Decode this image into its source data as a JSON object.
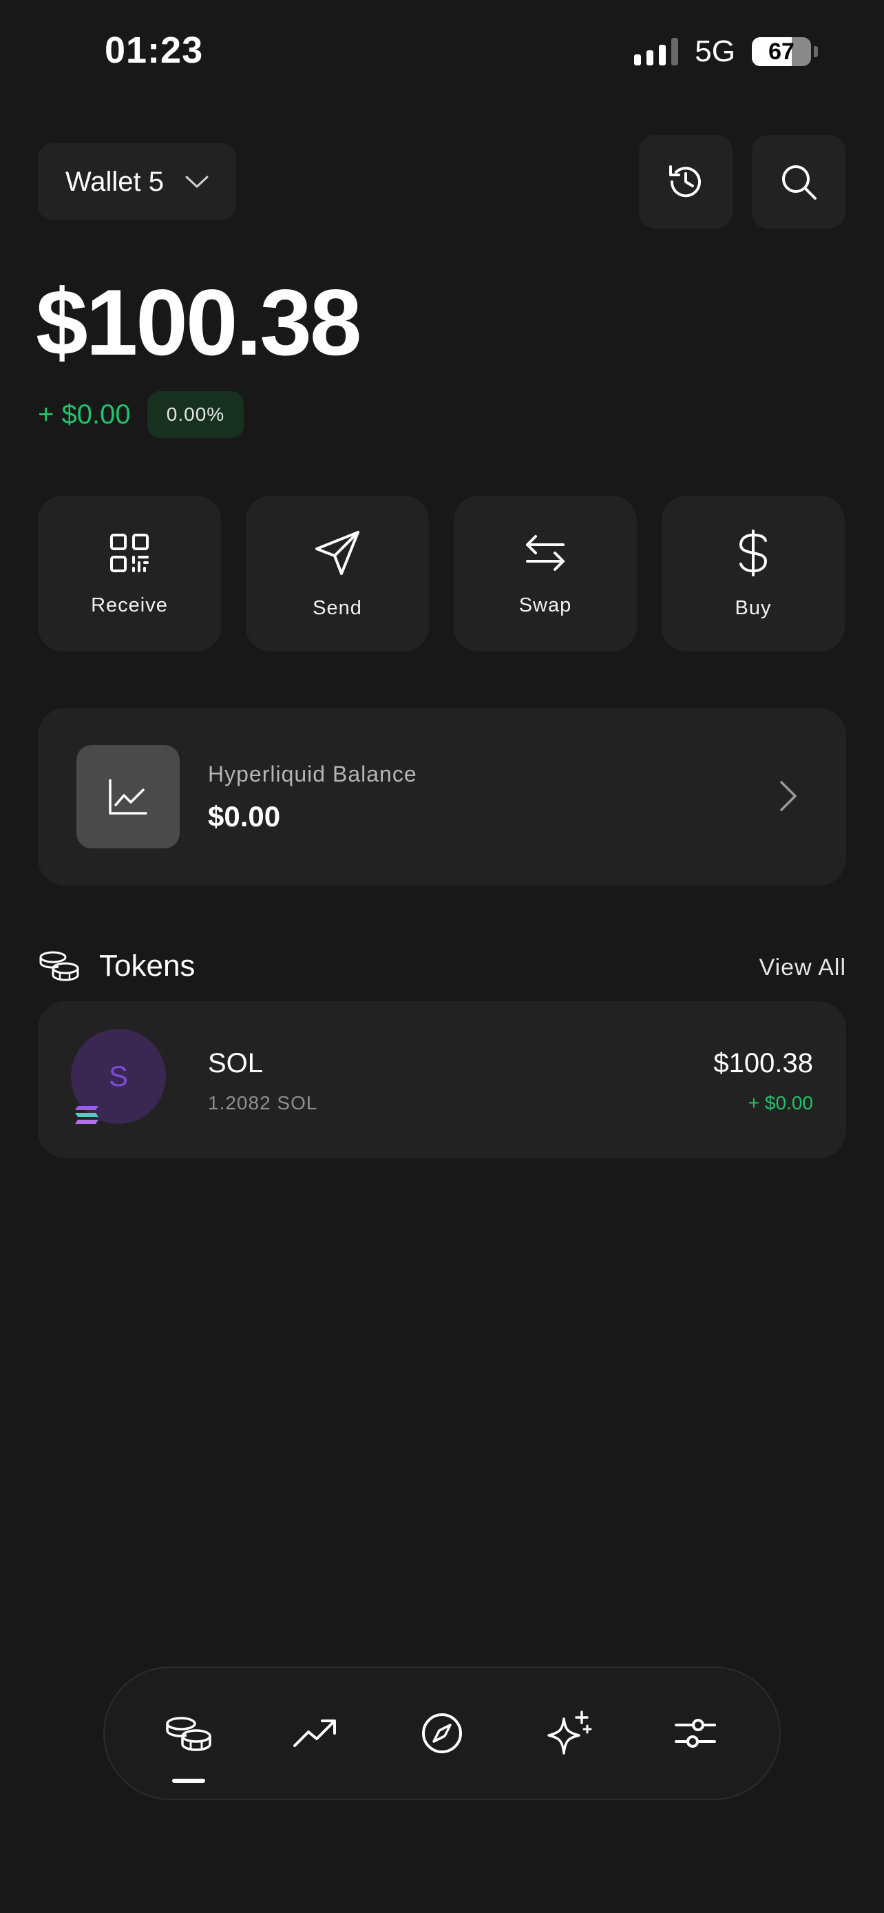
{
  "status_bar": {
    "time": "01:23",
    "network": "5G",
    "battery_level": "67",
    "battery_fraction": 0.67
  },
  "header": {
    "wallet_name": "Wallet 5",
    "icons": {
      "dropdown": "chevron-down-icon",
      "history": "history-icon",
      "search": "search-icon"
    }
  },
  "balance": {
    "total": "$100.38",
    "change_amount": "+ $0.00",
    "change_percent": "0.00%"
  },
  "actions": [
    {
      "label": "Receive",
      "icon": "qr-code-icon"
    },
    {
      "label": "Send",
      "icon": "send-icon"
    },
    {
      "label": "Swap",
      "icon": "swap-icon"
    },
    {
      "label": "Buy",
      "icon": "dollar-icon"
    }
  ],
  "hyperliquid": {
    "title": "Hyperliquid Balance",
    "value": "$0.00",
    "icon": "chart-line-icon"
  },
  "tokens": {
    "title": "Tokens",
    "view_all": "View All",
    "items": [
      {
        "avatar_letter": "S",
        "name": "SOL",
        "amount": "1.2082 SOL",
        "value": "$100.38",
        "change": "+ $0.00"
      }
    ]
  },
  "bottom_nav": {
    "items": [
      "coins-icon",
      "trending-up-icon",
      "compass-icon",
      "sparkles-icon",
      "sliders-icon"
    ],
    "active": "coins-icon"
  },
  "colors": {
    "background": "#181818",
    "card": "#222222",
    "positive": "#22c16b",
    "avatar_bg": "#3a2752",
    "avatar_fg": "#7c4ad6"
  }
}
